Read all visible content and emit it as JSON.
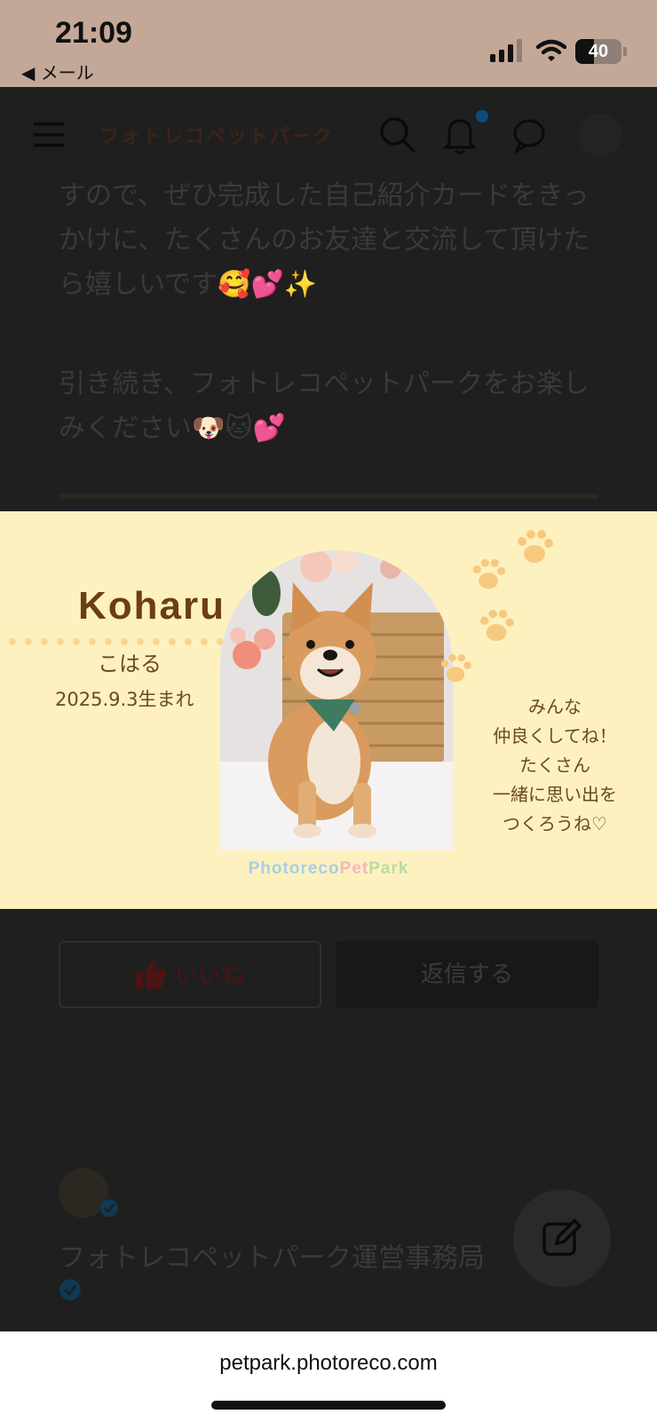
{
  "status": {
    "time": "21:09",
    "back_label": "◀ メール",
    "battery": "40"
  },
  "header": {
    "brand": "フォトレコペットパーク"
  },
  "article": {
    "paragraph1": "すので、ぜひ完成した自己紹介カードをきっかけに、たくさんのお友達と交流して頂けたら嬉しいです🥰💕✨",
    "paragraph2": "引き続き、フォトレコペットパークをお楽しみください🐶🐱💕"
  },
  "card": {
    "name": "Koharu",
    "kana": "こはる",
    "birth": "2025.9.3生まれ",
    "message_lines": [
      "みんな",
      "仲良くしてね！",
      "たくさん",
      "一緒に思い出を",
      "つくろうね♡"
    ],
    "logo_a": "Photoreco",
    "logo_b": "Pet",
    "logo_c": "Park"
  },
  "actions": {
    "like": "いいね",
    "reply": "返信する"
  },
  "comment": {
    "author": "フォトレコペットパーク運営事務局"
  },
  "browser": {
    "url": "petpark.photoreco.com"
  },
  "colors": {
    "card_bg": "#fdf1bf",
    "status_bg": "#c4a897",
    "name_brown": "#6b3f12"
  },
  "icons": [
    "menu-icon",
    "search-icon",
    "bell-icon",
    "chat-icon",
    "avatar-icon",
    "thumbs-up-icon",
    "verified-icon",
    "edit-icon",
    "paw-icon"
  ]
}
